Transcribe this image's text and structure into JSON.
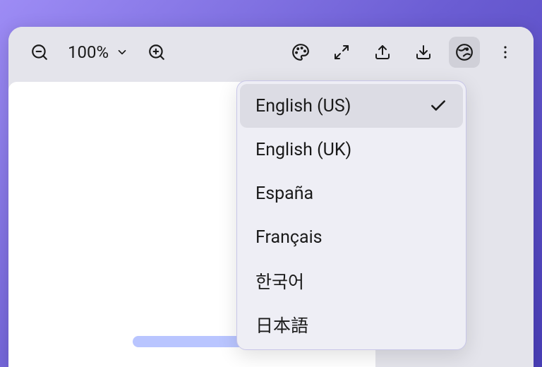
{
  "toolbar": {
    "zoom_level": "100%"
  },
  "language_menu": {
    "items": [
      {
        "label": "English (US)",
        "selected": true
      },
      {
        "label": "English (UK)",
        "selected": false
      },
      {
        "label": "España",
        "selected": false
      },
      {
        "label": "Français",
        "selected": false
      },
      {
        "label": "한국어",
        "selected": false
      },
      {
        "label": "日本語",
        "selected": false
      }
    ]
  }
}
